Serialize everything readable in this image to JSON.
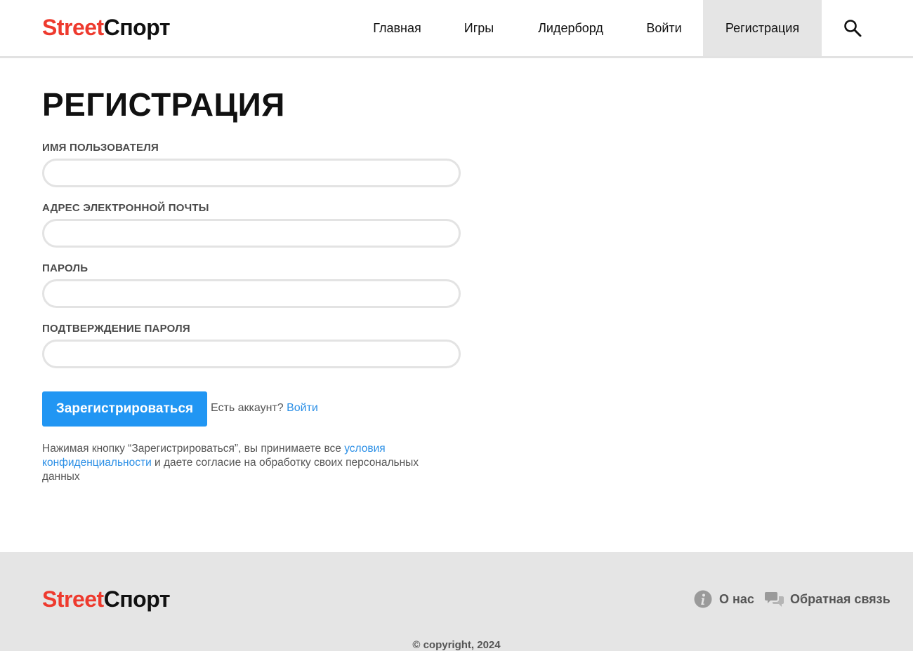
{
  "brand": {
    "part1": "Street",
    "part2": "Спорт",
    "color1": "#ee3a2e",
    "color2": "#111111"
  },
  "nav": {
    "items": [
      {
        "label": "Главная"
      },
      {
        "label": "Игры"
      },
      {
        "label": "Лидерборд"
      },
      {
        "label": "Войти"
      },
      {
        "label": "Регистрация",
        "active": true
      }
    ],
    "search_icon": "search-icon"
  },
  "page": {
    "title": "РЕГИСТРАЦИЯ"
  },
  "form": {
    "username": {
      "label": "ИМЯ ПОЛЬЗОВАТЕЛЯ",
      "value": "",
      "placeholder": ""
    },
    "email": {
      "label": "АДРЕС ЭЛЕКТРОННОЙ ПОЧТЫ",
      "value": "",
      "placeholder": ""
    },
    "password": {
      "label": "ПАРОЛЬ",
      "value": "",
      "placeholder": ""
    },
    "password_confirm": {
      "label": "ПОДТВЕРЖДЕНИЕ ПАРОЛЯ",
      "value": "",
      "placeholder": ""
    },
    "submit_label": "Зарегистрироваться",
    "have_account_text": "Есть аккаунт?",
    "login_link": "Войти",
    "consent_prefix": "Нажимая кнопку “Зарегистрироваться”, вы принимаете все",
    "consent_link": "условия конфиденциальности",
    "consent_suffix": "и даете согласие на обработку своих персональных данных"
  },
  "footer": {
    "about_label": "О нас",
    "about_icon": "info-icon",
    "feedback_label": "Обратная связь",
    "feedback_icon": "chat-bubbles-icon",
    "copyright": "© copyright, 2024"
  },
  "colors": {
    "accent": "#2196f3",
    "link": "#2b8fe6",
    "footer_bg": "#e5e5e5",
    "nav_active_bg": "#e5e5e5"
  }
}
